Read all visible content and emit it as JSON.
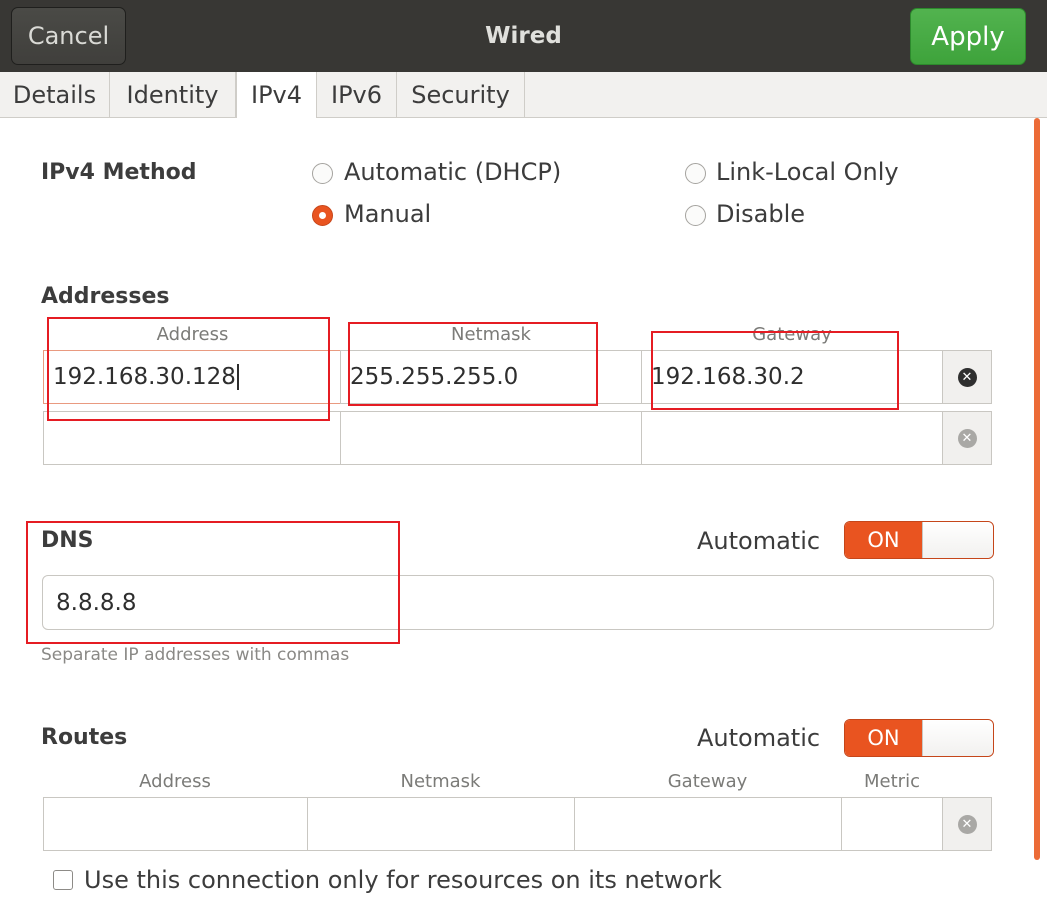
{
  "header": {
    "cancel_label": "Cancel",
    "title": "Wired",
    "apply_label": "Apply"
  },
  "tabs": [
    {
      "label": "Details",
      "active": false
    },
    {
      "label": "Identity",
      "active": false
    },
    {
      "label": "IPv4",
      "active": true
    },
    {
      "label": "IPv6",
      "active": false
    },
    {
      "label": "Security",
      "active": false
    }
  ],
  "ipv4_method": {
    "label": "IPv4 Method",
    "options": [
      {
        "label": "Automatic (DHCP)",
        "checked": false
      },
      {
        "label": "Manual",
        "checked": true
      },
      {
        "label": "Link-Local Only",
        "checked": false
      },
      {
        "label": "Disable",
        "checked": false
      }
    ]
  },
  "addresses": {
    "title": "Addresses",
    "columns": [
      "Address",
      "Netmask",
      "Gateway"
    ],
    "rows": [
      {
        "address": "192.168.30.128",
        "netmask": "255.255.255.0",
        "gateway": "192.168.30.2"
      },
      {
        "address": "",
        "netmask": "",
        "gateway": ""
      }
    ]
  },
  "dns": {
    "title": "DNS",
    "automatic_label": "Automatic",
    "switch_label": "ON",
    "value": "8.8.8.8",
    "hint": "Separate IP addresses with commas"
  },
  "routes": {
    "title": "Routes",
    "automatic_label": "Automatic",
    "switch_label": "ON",
    "columns": [
      "Address",
      "Netmask",
      "Gateway",
      "Metric"
    ],
    "rows": [
      {
        "address": "",
        "netmask": "",
        "gateway": "",
        "metric": ""
      }
    ]
  },
  "restrict_checkbox": {
    "label": "Use this connection only for resources on its network",
    "checked": false
  },
  "icons": {
    "delete_row": "clear-circle-icon"
  },
  "colors": {
    "accent": "#e95420",
    "apply_green": "#3ea33b",
    "header_bg": "#383734",
    "highlight_box": "#e51c23"
  }
}
